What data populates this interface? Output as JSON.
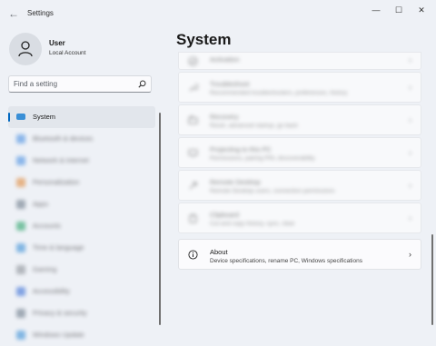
{
  "window": {
    "title": "Settings",
    "back_glyph": "←",
    "minimize_glyph": "—",
    "maximize_glyph": "☐",
    "close_glyph": "✕"
  },
  "profile": {
    "name": "User",
    "account_type": "Local Account"
  },
  "search": {
    "placeholder": "Find a setting",
    "icon": "search-icon"
  },
  "nav": {
    "items": [
      {
        "label": "System",
        "icon": "monitor-icon",
        "color": "#3a8fd6",
        "active": true
      },
      {
        "label": "Bluetooth & devices",
        "icon": "bluetooth-icon",
        "color": "#4a90e2"
      },
      {
        "label": "Network & internet",
        "icon": "wifi-icon",
        "color": "#4a90e2"
      },
      {
        "label": "Personalization",
        "icon": "brush-icon",
        "color": "#e08a3c"
      },
      {
        "label": "Apps",
        "icon": "apps-icon",
        "color": "#6c7a89"
      },
      {
        "label": "Accounts",
        "icon": "person-icon",
        "color": "#2aa36a"
      },
      {
        "label": "Time & language",
        "icon": "globe-icon",
        "color": "#3a8fd6"
      },
      {
        "label": "Gaming",
        "icon": "controller-icon",
        "color": "#8a8f96"
      },
      {
        "label": "Accessibility",
        "icon": "accessibility-icon",
        "color": "#3a6fd6"
      },
      {
        "label": "Privacy & security",
        "icon": "shield-icon",
        "color": "#6c7a89"
      },
      {
        "label": "Windows Update",
        "icon": "update-icon",
        "color": "#3a8fd6"
      }
    ]
  },
  "page": {
    "title": "System"
  },
  "cards": [
    {
      "title": "Activation",
      "desc": "",
      "icon": "check-circle-icon"
    },
    {
      "title": "Troubleshoot",
      "desc": "Recommended troubleshooters, preferences, history",
      "icon": "wrench-icon"
    },
    {
      "title": "Recovery",
      "desc": "Reset, advanced startup, go back",
      "icon": "recovery-icon"
    },
    {
      "title": "Projecting to this PC",
      "desc": "Permissions, pairing PIN, discoverability",
      "icon": "projector-icon"
    },
    {
      "title": "Remote Desktop",
      "desc": "Remote Desktop users, connection permissions",
      "icon": "remote-desktop-icon"
    },
    {
      "title": "Clipboard",
      "desc": "Cut and copy history, sync, clear",
      "icon": "clipboard-icon"
    },
    {
      "title": "About",
      "desc": "Device specifications, rename PC, Windows specifications",
      "icon": "info-icon"
    }
  ],
  "chevron_glyph": "›"
}
